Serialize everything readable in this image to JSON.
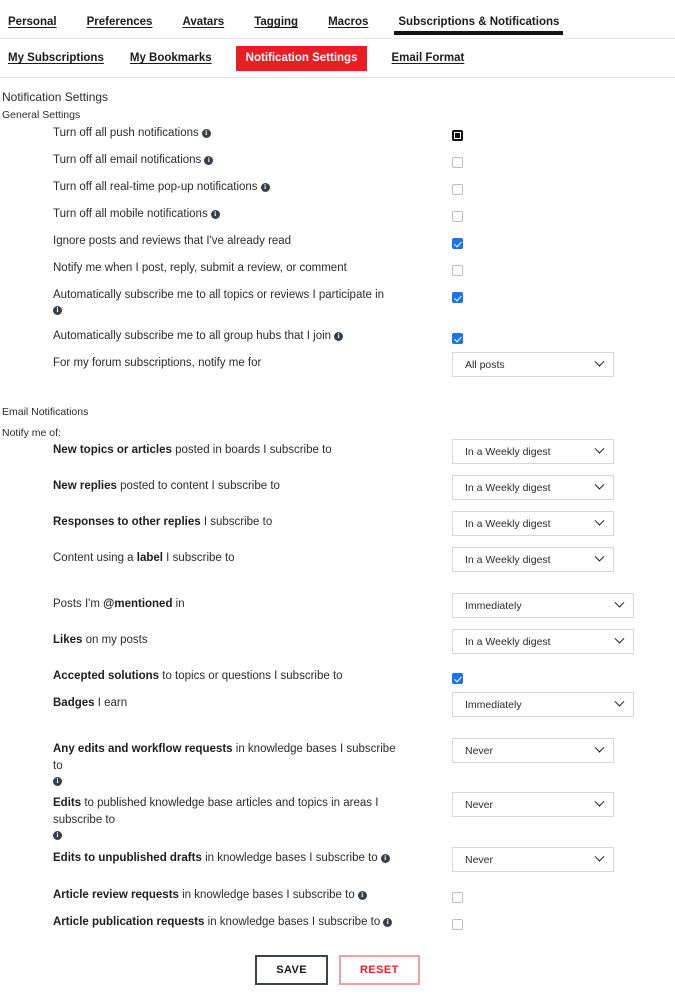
{
  "topnav": {
    "items": [
      {
        "label": "Personal",
        "active": false
      },
      {
        "label": "Preferences",
        "active": false
      },
      {
        "label": "Avatars",
        "active": false
      },
      {
        "label": "Tagging",
        "active": false
      },
      {
        "label": "Macros",
        "active": false
      },
      {
        "label": "Subscriptions & Notifications",
        "active": true
      }
    ]
  },
  "subtabs": {
    "items": [
      {
        "label": "My Subscriptions",
        "active": false
      },
      {
        "label": "My Bookmarks",
        "active": false
      },
      {
        "label": "Notification Settings",
        "active": true
      },
      {
        "label": "Email Format",
        "active": false
      }
    ]
  },
  "page": {
    "title": "Notification Settings",
    "general_section_title": "General Settings",
    "email_section_title": "Email Notifications",
    "notify_me_of_label": "Notify me of:"
  },
  "general_rows": [
    {
      "text": "Turn off all push notifications",
      "control": "checkbox",
      "checked": false,
      "focused": true,
      "info": "inline"
    },
    {
      "text": "Turn off all email notifications",
      "control": "checkbox",
      "checked": false,
      "focused": false,
      "info": "inline"
    },
    {
      "text": "Turn off all real-time pop-up notifications",
      "control": "checkbox",
      "checked": false,
      "focused": false,
      "info": "inline"
    },
    {
      "text": "Turn off all mobile notifications",
      "control": "checkbox",
      "checked": false,
      "focused": false,
      "info": "inline"
    },
    {
      "text": "Ignore posts and reviews that I've already read",
      "control": "checkbox",
      "checked": true,
      "focused": false,
      "info": "none"
    },
    {
      "text": "Notify me when I post, reply, submit a review, or comment",
      "control": "checkbox",
      "checked": false,
      "focused": false,
      "info": "none"
    },
    {
      "text": "Automatically subscribe me to all topics or reviews I participate in",
      "control": "checkbox",
      "checked": true,
      "focused": false,
      "info": "block"
    },
    {
      "text": "Automatically subscribe me to all group hubs that I join",
      "control": "checkbox",
      "checked": true,
      "focused": false,
      "info": "inline"
    },
    {
      "text": "For my forum subscriptions, notify me for",
      "control": "select",
      "value": "All posts",
      "width": "narrow",
      "info": "none"
    }
  ],
  "email_rows": [
    {
      "bold": "New topics or articles",
      "rest": " posted in boards I subscribe to",
      "control": "select",
      "value": "In a Weekly digest",
      "width": "narrow",
      "info": "none"
    },
    {
      "bold": "New replies",
      "rest": " posted to content I subscribe to",
      "control": "select",
      "value": "In a Weekly digest",
      "width": "narrow",
      "info": "none"
    },
    {
      "bold": "Responses to other replies",
      "rest": " I subscribe to",
      "control": "select",
      "value": "In a Weekly digest",
      "width": "narrow",
      "info": "none"
    },
    {
      "pre": "Content using a ",
      "bold": "label",
      "rest": " I subscribe to",
      "control": "select",
      "value": "In a Weekly digest",
      "width": "narrow",
      "info": "none"
    },
    {
      "pre": "Posts I'm ",
      "bold": "@mentioned",
      "rest": " in",
      "control": "select",
      "value": "Immediately",
      "width": "wide",
      "info": "none"
    },
    {
      "bold": "Likes",
      "rest": " on my posts",
      "control": "select",
      "value": "In a Weekly digest",
      "width": "wide",
      "info": "none"
    },
    {
      "bold": "Accepted solutions",
      "rest": " to topics or questions I subscribe to",
      "control": "checkbox",
      "checked": true,
      "info": "none"
    },
    {
      "bold": "Badges",
      "rest": " I earn",
      "control": "select",
      "value": "Immediately",
      "width": "wide",
      "info": "none"
    },
    {
      "bold": "Any edits and workflow requests",
      "rest": " in knowledge bases I subscribe to",
      "control": "select",
      "value": "Never",
      "width": "narrow",
      "info": "block"
    },
    {
      "bold": "Edits",
      "rest": " to published knowledge base articles and topics in areas I subscribe to",
      "control": "select",
      "value": "Never",
      "width": "narrow",
      "info": "block"
    },
    {
      "bold": "Edits to unpublished drafts",
      "rest": " in knowledge bases I subscribe to",
      "control": "select",
      "value": "Never",
      "width": "narrow",
      "info": "inline"
    },
    {
      "bold": "Article review requests",
      "rest": " in knowledge bases I subscribe to",
      "control": "checkbox",
      "checked": false,
      "info": "inline"
    },
    {
      "bold": "Article publication requests",
      "rest": " in knowledge bases I subscribe to",
      "control": "checkbox",
      "checked": false,
      "info": "inline"
    }
  ],
  "footer": {
    "save_label": "SAVE",
    "reset_label": "RESET"
  },
  "colors": {
    "accent_red": "#ec1c24",
    "checkbox_blue": "#1a73e8",
    "text": "#2b2b2b"
  }
}
